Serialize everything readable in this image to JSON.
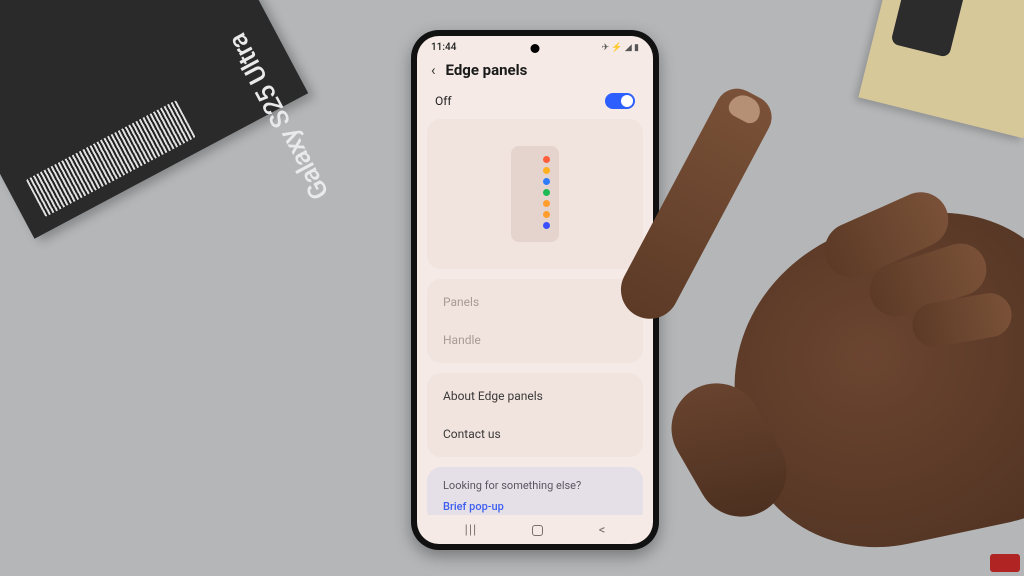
{
  "scene": {
    "box_label": "Galaxy S25 Ultra"
  },
  "status": {
    "time": "11:44",
    "indicators": "✈ ⚡ ◢ ▮"
  },
  "header": {
    "title": "Edge panels"
  },
  "toggle": {
    "state_label": "Off",
    "on": true
  },
  "preview": {
    "dot_colors": [
      "#ff5e3a",
      "#ffb020",
      "#2e7bff",
      "#1db954",
      "#ff9e2e",
      "#ff9e2e",
      "#3a4fff"
    ]
  },
  "menu": {
    "panels": "Panels",
    "handle": "Handle",
    "about": "About Edge panels",
    "contact": "Contact us"
  },
  "lookup": {
    "title": "Looking for something else?",
    "link1": "Brief pop-up"
  },
  "nav": {
    "recent": "|||",
    "back": "<"
  }
}
